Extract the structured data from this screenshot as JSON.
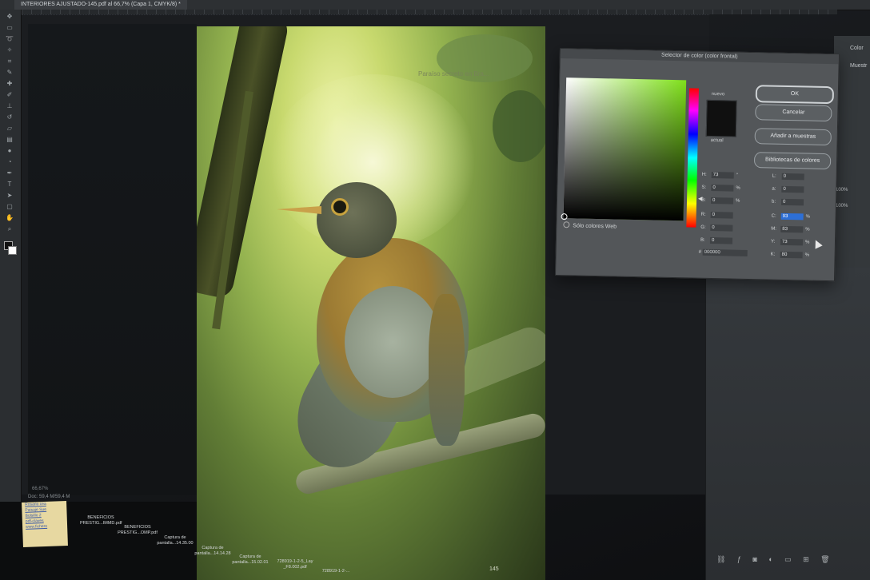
{
  "titlebar": {
    "tab_label": "INTERIORES AJUSTADO-145.pdf al 66,7% (Capa 1, CMYK/8) *"
  },
  "status": {
    "zoom": "66,67%",
    "doc": "Doc: 59,4 M/59,4 M"
  },
  "photo": {
    "caption": "Paraíso secreto en Bra...",
    "page_number": "145"
  },
  "dialog": {
    "title": "Selector de color (color frontal)",
    "label_new": "nuevo",
    "label_current": "actual",
    "buttons": {
      "ok": "OK",
      "cancel": "Cancelar",
      "add_swatches": "Añadir a muestras",
      "libraries": "Bibliotecas de colores"
    },
    "web_only": "Sólo colores Web",
    "fields": {
      "H": {
        "label": "H:",
        "value": "73",
        "unit": "°"
      },
      "S": {
        "label": "S:",
        "value": "0",
        "unit": "%"
      },
      "B": {
        "label": "B:",
        "value": "0",
        "unit": "%"
      },
      "R": {
        "label": "R:",
        "value": "0",
        "unit": ""
      },
      "G": {
        "label": "G:",
        "value": "0",
        "unit": ""
      },
      "Bl": {
        "label": "B:",
        "value": "0",
        "unit": ""
      },
      "L": {
        "label": "L:",
        "value": "0",
        "unit": ""
      },
      "a": {
        "label": "a:",
        "value": "0",
        "unit": ""
      },
      "b": {
        "label": "b:",
        "value": "0",
        "unit": ""
      },
      "C": {
        "label": "C:",
        "value": "93",
        "unit": "%"
      },
      "M": {
        "label": "M:",
        "value": "83",
        "unit": "%"
      },
      "Y": {
        "label": "Y:",
        "value": "73",
        "unit": "%"
      },
      "K": {
        "label": "K:",
        "value": "80",
        "unit": "%"
      }
    },
    "hex": {
      "label": "#",
      "value": "000000"
    }
  },
  "panels": {
    "color_label": "Color",
    "swatches_label": "Muestr",
    "opacity_value": "100%",
    "fill_value": "100%"
  },
  "desktop": {
    "sticky_lines": [
      "Rosario cea",
      "Paisaje Sue",
      "Bolsillo 2",
      "pdf-claves",
      "www.fichero"
    ],
    "files": [
      {
        "line1": "BENEFICIOS",
        "line2": "PRESTIG...IMMD.pdf"
      },
      {
        "line1": "BENEFICIOS",
        "line2": "PRESTIG...OMP.pdf"
      },
      {
        "line1": "Captura de",
        "line2": "pantalla...14.35.00"
      },
      {
        "line1": "Captura de",
        "line2": "pantalla...14.14.28"
      },
      {
        "line1": "Captura de",
        "line2": "pantalla...15.02.01"
      },
      {
        "line1": "728919-1-2-5_Lay",
        "line2": "_F8.002.pdf"
      },
      {
        "line1": "728919-1-2-...",
        "line2": "_F8.001.pdf"
      }
    ]
  },
  "colors": {
    "accent": "#2d6fd6",
    "hue_selected": "#7fe01a",
    "preview_new": "#101010"
  }
}
